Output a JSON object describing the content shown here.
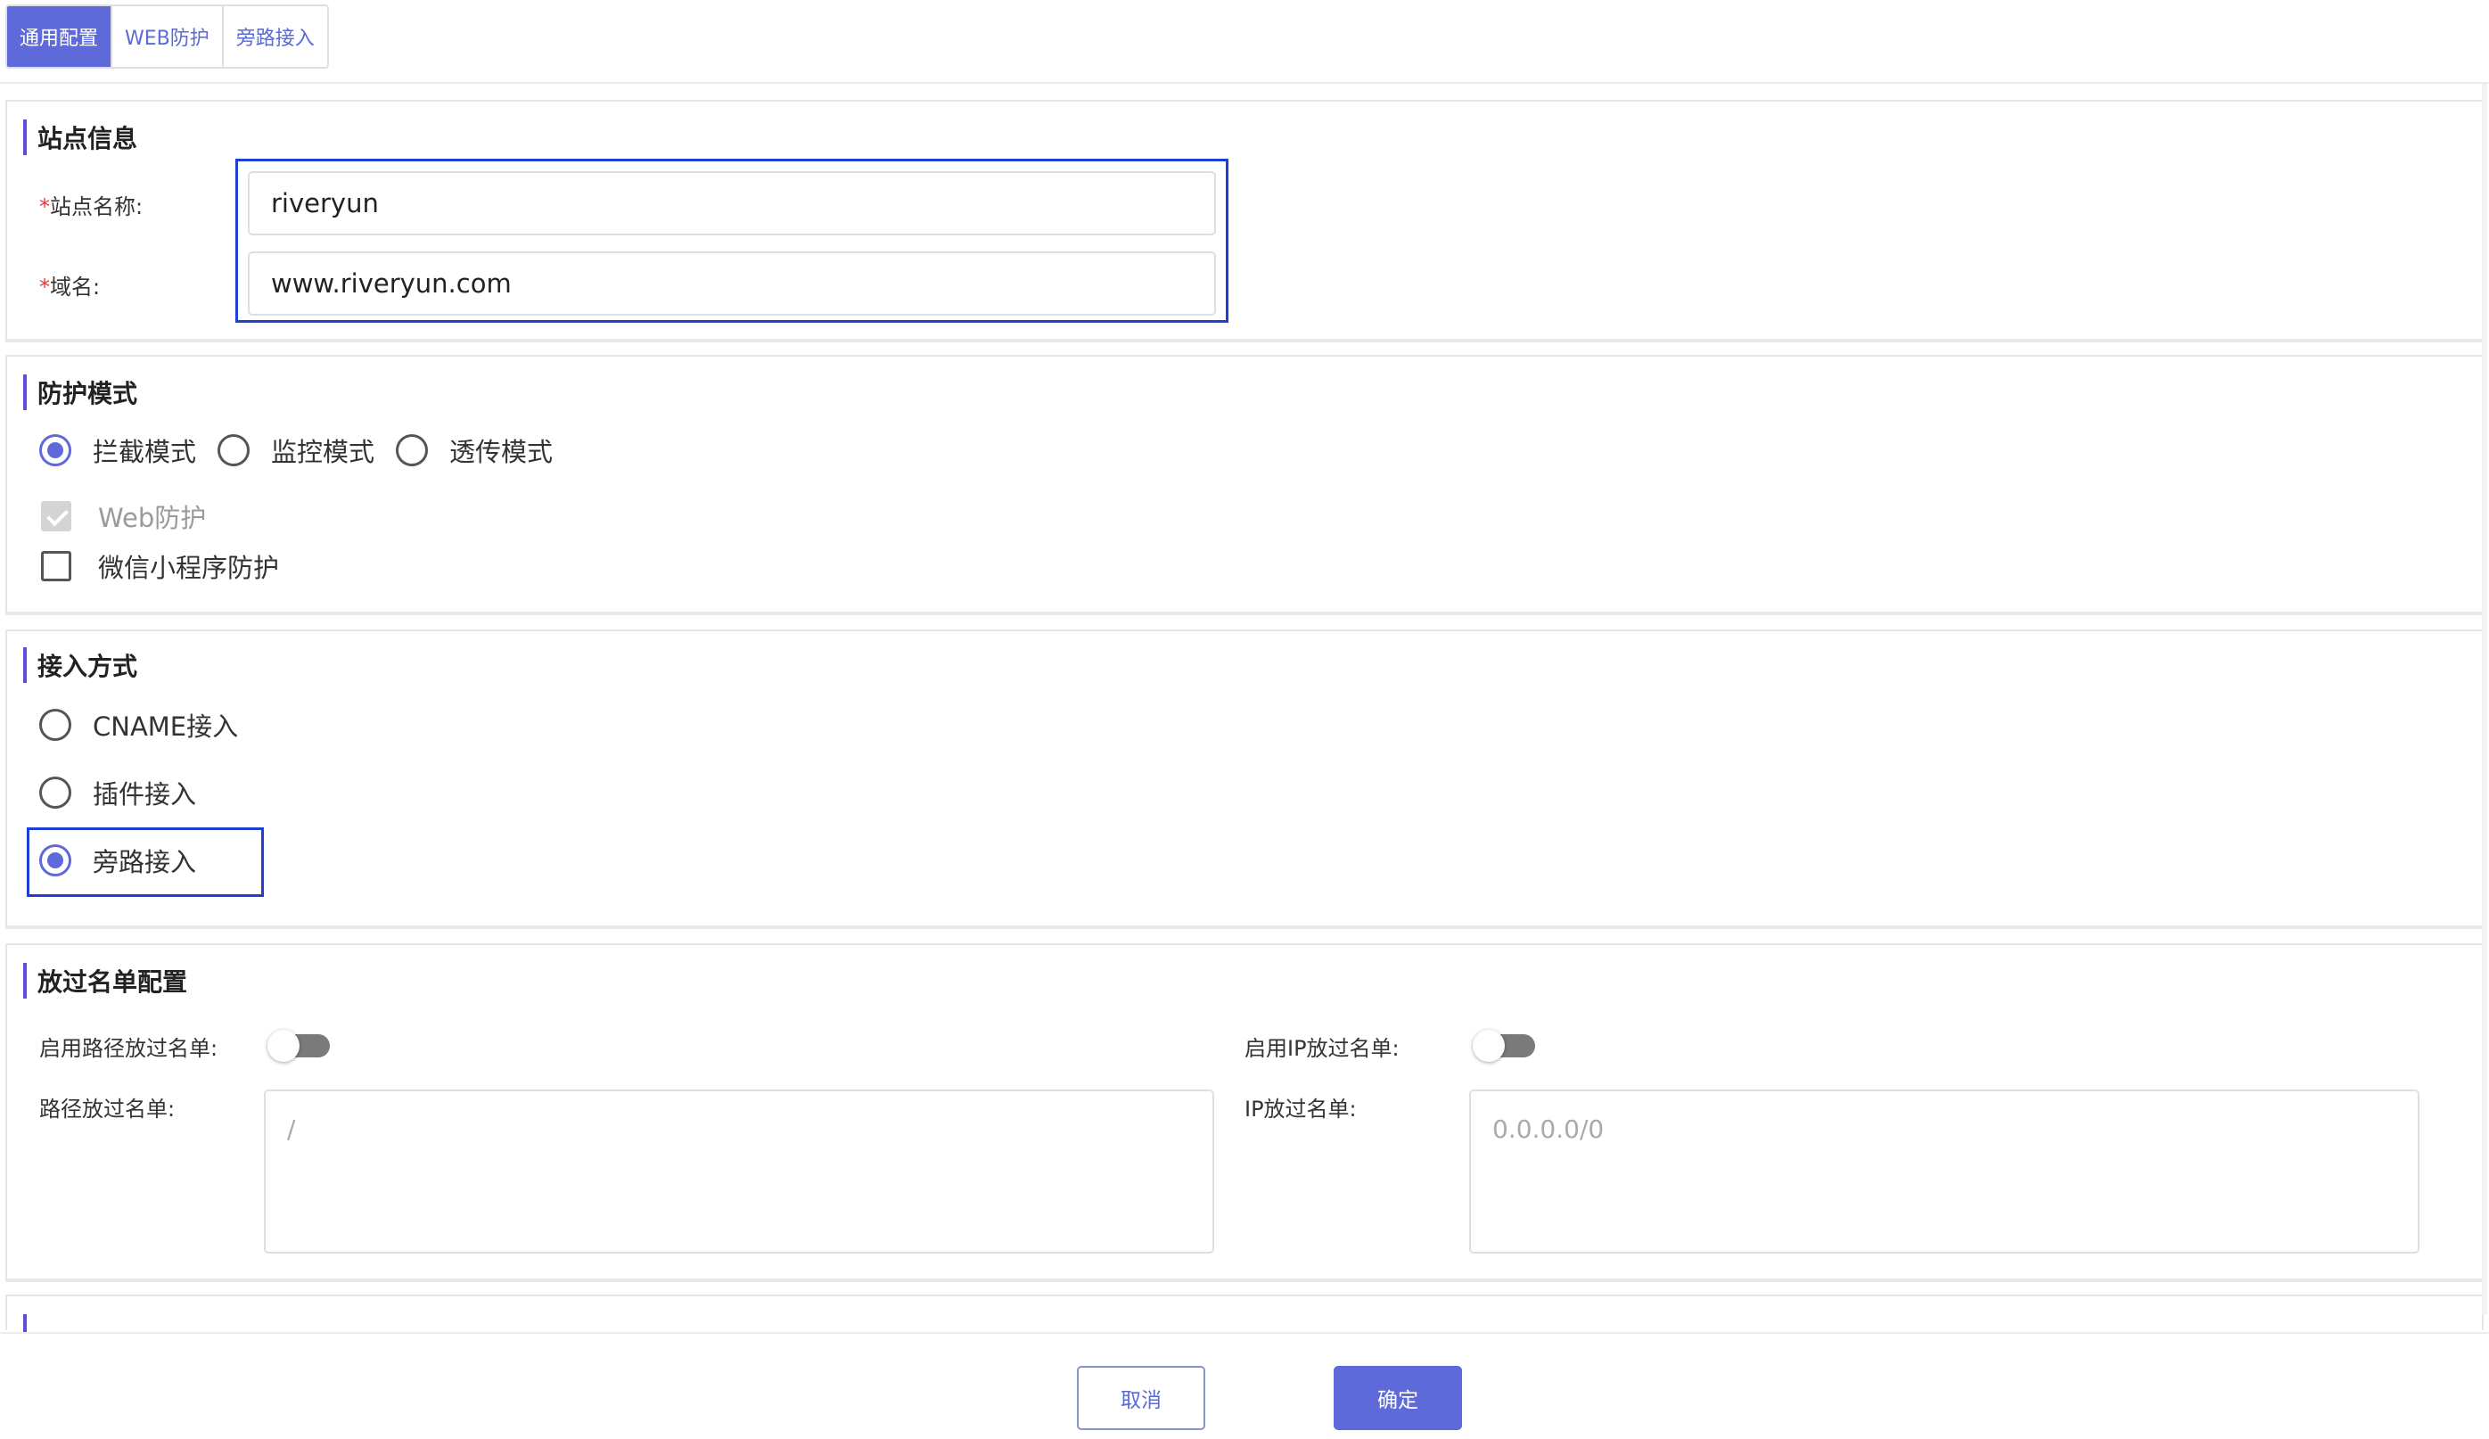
{
  "tabs": [
    {
      "label": "通用配置",
      "active": true
    },
    {
      "label": "WEB防护",
      "active": false
    },
    {
      "label": "旁路接入",
      "active": false
    }
  ],
  "site_info": {
    "title": "站点信息",
    "required_mark": "*",
    "name_label": "站点名称:",
    "name_value": "riveryun",
    "domain_label": "域名:",
    "domain_value": "www.riveryun.com"
  },
  "protection_mode": {
    "title": "防护模式",
    "modes": [
      {
        "label": "拦截模式",
        "checked": true
      },
      {
        "label": "监控模式",
        "checked": false
      },
      {
        "label": "透传模式",
        "checked": false
      }
    ],
    "web_protect": {
      "label": "Web防护",
      "checked": true,
      "disabled": true
    },
    "miniprogram_protect": {
      "label": "微信小程序防护",
      "checked": false
    }
  },
  "access_method": {
    "title": "接入方式",
    "options": [
      {
        "label": "CNAME接入",
        "checked": false
      },
      {
        "label": "插件接入",
        "checked": false
      },
      {
        "label": "旁路接入",
        "checked": true
      }
    ]
  },
  "allowlist": {
    "title": "放过名单配置",
    "path_switch_label": "启用路径放过名单:",
    "path_switch_on": false,
    "ip_switch_label": "启用IP放过名单:",
    "ip_switch_on": false,
    "path_list_label": "路径放过名单:",
    "path_list_placeholder": "/",
    "ip_list_label": "IP放过名单:",
    "ip_list_placeholder": "0.0.0.0/0"
  },
  "footer": {
    "cancel_label": "取消",
    "ok_label": "确定"
  },
  "colors": {
    "accent": "#5e6ad9",
    "section_bar": "#5e4bd9",
    "highlight_border": "#1f3fd4",
    "required": "#e23c3c"
  }
}
